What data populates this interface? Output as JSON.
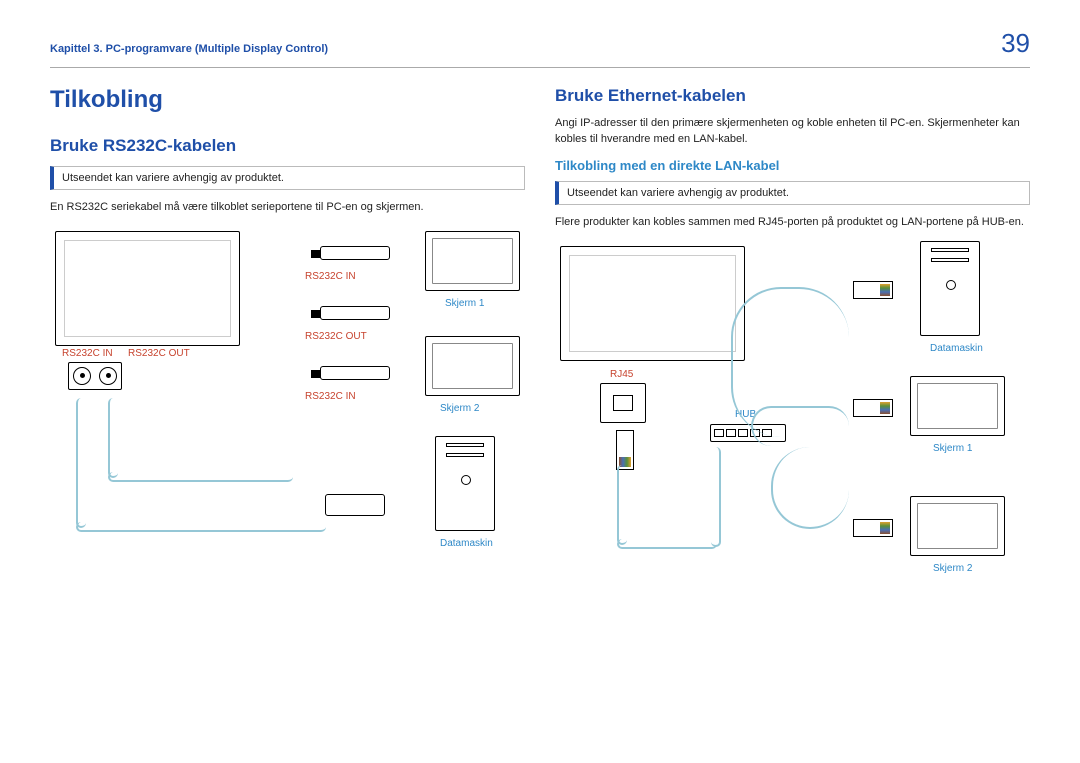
{
  "header": {
    "chapter": "Kapittel 3. PC-programvare (Multiple Display Control)",
    "page": "39"
  },
  "left": {
    "title": "Tilkobling",
    "h2": "Bruke RS232C-kabelen",
    "note": "Utseendet kan variere avhengig av produktet.",
    "body": "En RS232C seriekabel må være tilkoblet serieportene til PC-en og skjermen.",
    "labels": {
      "rs_in_a": "RS232C IN",
      "rs_out_a": "RS232C OUT",
      "rs_in_b": "RS232C IN",
      "rs_out_b": "RS232C OUT",
      "rs_in_c": "RS232C IN",
      "screen1": "Skjerm 1",
      "screen2": "Skjerm 2",
      "pc": "Datamaskin"
    }
  },
  "right": {
    "h2": "Bruke Ethernet-kabelen",
    "body1": "Angi IP-adresser til den primære skjermenheten og koble enheten til PC-en. Skjermenheter kan kobles til hverandre med en LAN-kabel.",
    "h3": "Tilkobling med en direkte LAN-kabel",
    "note": "Utseendet kan variere avhengig av produktet.",
    "body2": "Flere produkter kan kobles sammen med RJ45-porten på produktet og LAN-portene på HUB-en.",
    "labels": {
      "rj45": "RJ45",
      "hub": "HUB",
      "pc": "Datamaskin",
      "screen1": "Skjerm 1",
      "screen2": "Skjerm 2"
    }
  }
}
